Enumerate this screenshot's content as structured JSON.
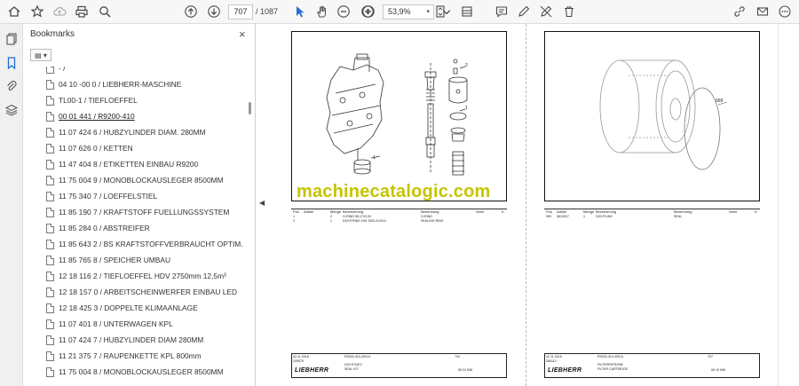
{
  "toolbar": {
    "page_current": "707",
    "page_total": "/ 1087",
    "zoom": "53,9%",
    "zoom_arrow": "▾"
  },
  "bookmarks": {
    "title": "Bookmarks",
    "close": "×",
    "options_label": "▤ ▾",
    "items": [
      {
        "label": "- /"
      },
      {
        "label": "04 10 -00 0 / LIEBHERR-MASCHINE"
      },
      {
        "label": "TL00-1 / TIEFLOEFFEL"
      },
      {
        "label": "00 01 441 / R9200-410"
      },
      {
        "label": "11 07 424 6 / HUBZYLINDER DIAM. 280MM"
      },
      {
        "label": "11 07 626 0 / KETTEN"
      },
      {
        "label": "11 47 404 8 / ETIKETTEN EINBAU R9200"
      },
      {
        "label": "11 75 004 9 / MONOBLOCKAUSLEGER 8500MM"
      },
      {
        "label": "11 75 340 7 / LOEFFELSTIEL"
      },
      {
        "label": "11 85 190 7 / KRAFTSTOFF FUELLUNGSSYSTEM"
      },
      {
        "label": "11 85 284 0 / ABSTREIFER"
      },
      {
        "label": "11 85 643 2 / BS KRAFTSTOFFVERBRAUCHT OPTIM."
      },
      {
        "label": "11 85 765 8 / SPEICHER UMBAU"
      },
      {
        "label": "12 18 116 2 / TIEFLOEFFEL HDV 2750mm 12,5m³"
      },
      {
        "label": "12 18 157 0 / ARBEITSCHEINWERFER EINBAU LED"
      },
      {
        "label": "12 18 425 3 / DOPPELTE KLIMAANLAGE"
      },
      {
        "label": "11 07 401 8 / UNTERWAGEN KPL"
      },
      {
        "label": "11 07 424 7 / HUBZYLINDER DIAM 280MM"
      },
      {
        "label": "11 21 375 7 / RAUPENKETTE KPL 800mm"
      },
      {
        "label": "11 75 004 8 / MONOBLOCKAUSLEGER 8500MM"
      }
    ]
  },
  "watermark": "machinecatalogic.com",
  "page_left": {
    "callouts": [
      "2",
      "1",
      "2",
      "1"
    ],
    "table_header": [
      "Pos",
      "Artikel",
      "Menge",
      "Bezeichnung",
      "Benennung",
      "Serie",
      "K"
    ],
    "rows": [
      [
        "1",
        "",
        "2",
        "O-RING 55,17X2,62",
        "O-RING",
        "",
        ""
      ],
      [
        "2",
        "",
        "1",
        "DICHTRING DIN 7603-A 6X10",
        "SEALING RING",
        "",
        ""
      ]
    ],
    "title_block": {
      "date": "02.11.2016",
      "code": "105575",
      "drawing": "R9200-410-40014",
      "name_de": "DICHTSATZ",
      "name_en": "SEAL KIT",
      "sheet": "704",
      "number": "06 04 008",
      "logo": "LIEBHERR"
    }
  },
  "page_right": {
    "callouts": [
      "999"
    ],
    "table_header": [
      "Pos",
      "Artikel",
      "Menge",
      "Bezeichnung",
      "Benennung",
      "Serie",
      "K"
    ],
    "rows": [
      [
        "999",
        "5612817",
        "1",
        "DICHTUNG",
        "SEAL",
        "",
        ""
      ]
    ],
    "title_block": {
      "date": "02.11.2016",
      "code": "285112",
      "drawing": "R9200-410-40014",
      "name_de": "FILTERPATRONE",
      "name_en": "FILTER CARTRIDGE",
      "sheet": "707",
      "number": "06 10 065",
      "logo": "LIEBHERR"
    }
  }
}
